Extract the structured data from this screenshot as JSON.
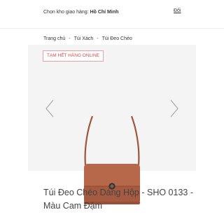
{
  "topbar": {
    "store_label": "Chọn kho giao hàng:",
    "store_value": "Hồ Chí Minh",
    "change_link": "Đổi"
  },
  "breadcrumb": {
    "items": [
      "Trang chủ",
      "Túi Xách",
      "Túi Đeo Chéo"
    ],
    "separator": "-"
  },
  "gallery": {
    "badge": "TẠM HẾT HÀNG ONLINE",
    "prev_icon": "chevron-left-icon",
    "next_icon": "chevron-right-icon"
  },
  "product": {
    "title": "Túi Đeo Chéo Dáng Hộp - SHO 0133 - Màu Cam Đậm",
    "color": "#a65a3f"
  },
  "colors": {
    "badge_text": "#d04a4a",
    "badge_border": "#e4a2a2",
    "gallery_bg": "#f4f4f4"
  }
}
